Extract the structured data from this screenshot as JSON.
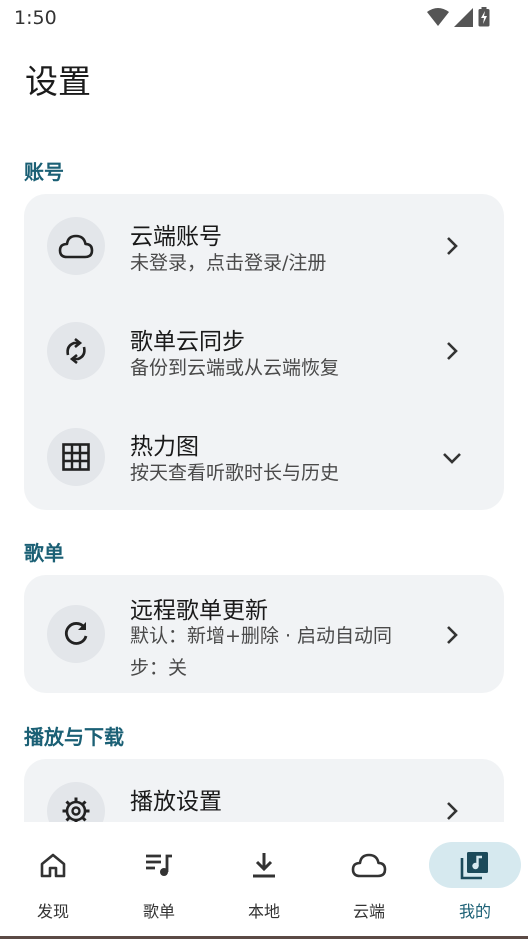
{
  "status_bar": {
    "time": "1:50",
    "icons": [
      "wifi-icon",
      "signal-icon",
      "battery-charging-icon"
    ]
  },
  "page": {
    "title": "设置"
  },
  "sections": {
    "account": {
      "header": "账号",
      "items": [
        {
          "title": "云端账号",
          "subtitle": "未登录，点击登录/注册",
          "icon": "cloud-icon",
          "trailing": "chevron-right"
        },
        {
          "title": "歌单云同步",
          "subtitle": "备份到云端或从云端恢复",
          "icon": "sync-icon",
          "trailing": "chevron-right"
        },
        {
          "title": "热力图",
          "subtitle": "按天查看听歌时长与历史",
          "icon": "grid-icon",
          "trailing": "chevron-down"
        }
      ]
    },
    "playlist": {
      "header": "歌单",
      "items": [
        {
          "title": "远程歌单更新",
          "subtitle": "默认：新增+删除 · 启动自动同步：关",
          "icon": "refresh-icon",
          "trailing": "chevron-right"
        }
      ]
    },
    "playback": {
      "header": "播放与下载",
      "items": [
        {
          "title": "播放设置",
          "icon": "gear-icon",
          "trailing": "chevron-right"
        }
      ]
    }
  },
  "bottom_nav": {
    "items": [
      {
        "label": "发现",
        "icon": "home-icon",
        "active": false
      },
      {
        "label": "歌单",
        "icon": "playlist-icon",
        "active": false
      },
      {
        "label": "本地",
        "icon": "download-icon",
        "active": false
      },
      {
        "label": "云端",
        "icon": "cloud-icon",
        "active": false
      },
      {
        "label": "我的",
        "icon": "music-library-icon",
        "active": true
      }
    ]
  },
  "colors": {
    "accent": "#1b6075",
    "card_bg": "#f1f3f5",
    "icon_circle_bg": "#e3e6ea",
    "nav_active_bg": "#d6e9ef"
  }
}
